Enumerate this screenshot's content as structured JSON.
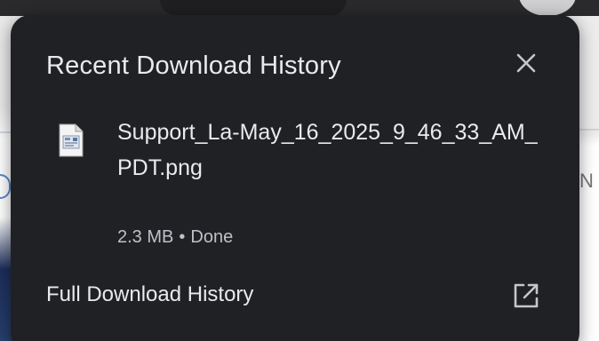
{
  "popup": {
    "title": "Recent Download History",
    "close_icon": "close-icon"
  },
  "downloads": [
    {
      "file_name": "Support_La-May_16_2025_9_46_33_AM_PDT.png",
      "size": "2.3 MB",
      "separator": "•",
      "status": "Done",
      "icon": "image-file-icon"
    }
  ],
  "footer": {
    "full_history_label": "Full Download History",
    "open_icon": "open-in-new-icon"
  },
  "colors": {
    "popup_bg": "#202124",
    "text_primary": "#e8eaed",
    "text_secondary": "#bdc1c6",
    "icon": "#c4c7c5"
  },
  "background": {
    "right_edge_letter": "N"
  }
}
